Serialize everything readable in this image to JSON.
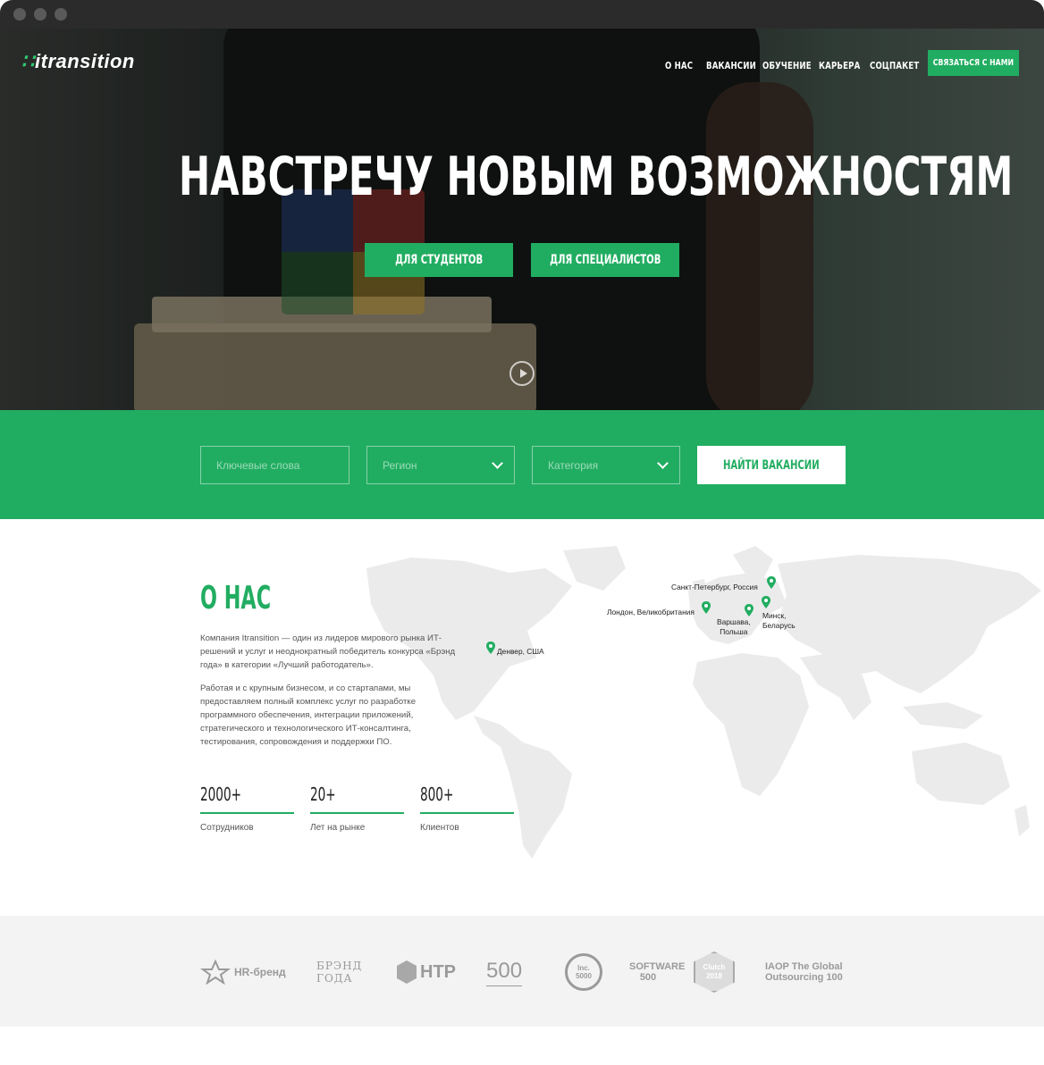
{
  "brand": {
    "logo_text": "itransition",
    "logo_mark": "∷",
    "accent_color": "#21ad61"
  },
  "nav": {
    "items": [
      {
        "label": "О НАС"
      },
      {
        "label": "ВАКАНСИИ"
      },
      {
        "label": "ОБУЧЕНИЕ"
      },
      {
        "label": "КАРЬЕРА"
      },
      {
        "label": "СОЦПАКЕТ"
      }
    ],
    "contact_label": "СВЯЗАТЬСЯ С НАМИ"
  },
  "hero": {
    "title": "НАВСТРЕЧУ НОВЫМ ВОЗМОЖНОСТЯМ",
    "buttons": [
      {
        "label": "ДЛЯ СТУДЕНТОВ"
      },
      {
        "label": "ДЛЯ СПЕЦИАЛИСТОВ"
      }
    ],
    "play_icon": "play-circle-icon"
  },
  "search": {
    "keywords_placeholder": "Ключевые слова",
    "region_placeholder": "Регион",
    "category_placeholder": "Категория",
    "submit_label": "НАЙТИ ВАКАНСИИ"
  },
  "about": {
    "title": "О НАС",
    "paragraph1": "Компания Itransition — один из лидеров мирового рынка ИТ-решений и услуг и неоднократный победитель конкурса «Брэнд года» в категории «Лучший работодатель».",
    "paragraph2": "Работая и с крупным бизнесом, и со стартапами, мы предоставляем полный комплекс услуг по разработке программного обеспечения, интеграции приложений, стратегического и технологического ИТ-консалтинга, тестирования, сопровождения и поддержки ПО.",
    "stats": [
      {
        "value": "2000+",
        "label": "Сотрудников"
      },
      {
        "value": "20+",
        "label": "Лет на рынке"
      },
      {
        "value": "800+",
        "label": "Клиентов"
      }
    ],
    "locations": [
      {
        "label": "Денвер, США"
      },
      {
        "label": "Санкт-Петербург, Россия"
      },
      {
        "label": "Лондон, Великобритания"
      },
      {
        "label": "Варшава,\nПольша"
      },
      {
        "label": "Минск,\nБеларусь"
      }
    ]
  },
  "awards": [
    {
      "label": "HR-бренд"
    },
    {
      "label": "БРЭНД ГОДА"
    },
    {
      "label": "HTP"
    },
    {
      "label": "500"
    },
    {
      "label": "Inc. 5000"
    },
    {
      "label": "SOFTWARE 500"
    },
    {
      "label": "Clutch 2018"
    },
    {
      "label": "IAOP The Global Outsourcing 100"
    }
  ]
}
